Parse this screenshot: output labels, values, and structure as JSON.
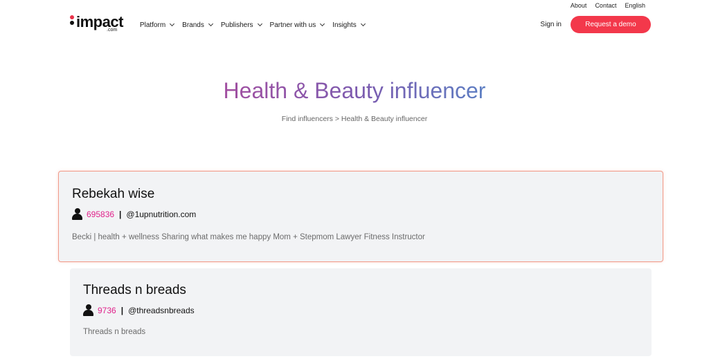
{
  "utility": {
    "about": "About",
    "contact": "Contact",
    "language": "English"
  },
  "logo": {
    "text": "impact",
    "sub": ".com"
  },
  "nav": [
    {
      "label": "Platform"
    },
    {
      "label": "Brands"
    },
    {
      "label": "Publishers"
    },
    {
      "label": "Partner with us"
    },
    {
      "label": "Insights"
    }
  ],
  "header": {
    "sign_in": "Sign in",
    "demo": "Request a demo"
  },
  "hero": {
    "title": "Health & Beauty influencer",
    "breadcrumb": "Find influencers > Health & Beauty influencer"
  },
  "influencers": [
    {
      "name": "Rebekah wise",
      "followers": "695836",
      "separator": "|",
      "handle": "@1upnutrition.com",
      "description": "Becki | health + wellness Sharing what makes me happy Mom + Stepmom Lawyer Fitness Instructor"
    },
    {
      "name": "Threads n breads",
      "followers": "9736",
      "separator": "|",
      "handle": "@threadsnbreads",
      "description": "Threads n breads"
    }
  ],
  "colors": {
    "accent": "#f3384b",
    "followers": "#e0218a",
    "card_border": "#f19a88",
    "card_bg": "#f2f3f5"
  },
  "icons": {
    "chevron": "chevron-down-icon",
    "person": "person-icon"
  }
}
